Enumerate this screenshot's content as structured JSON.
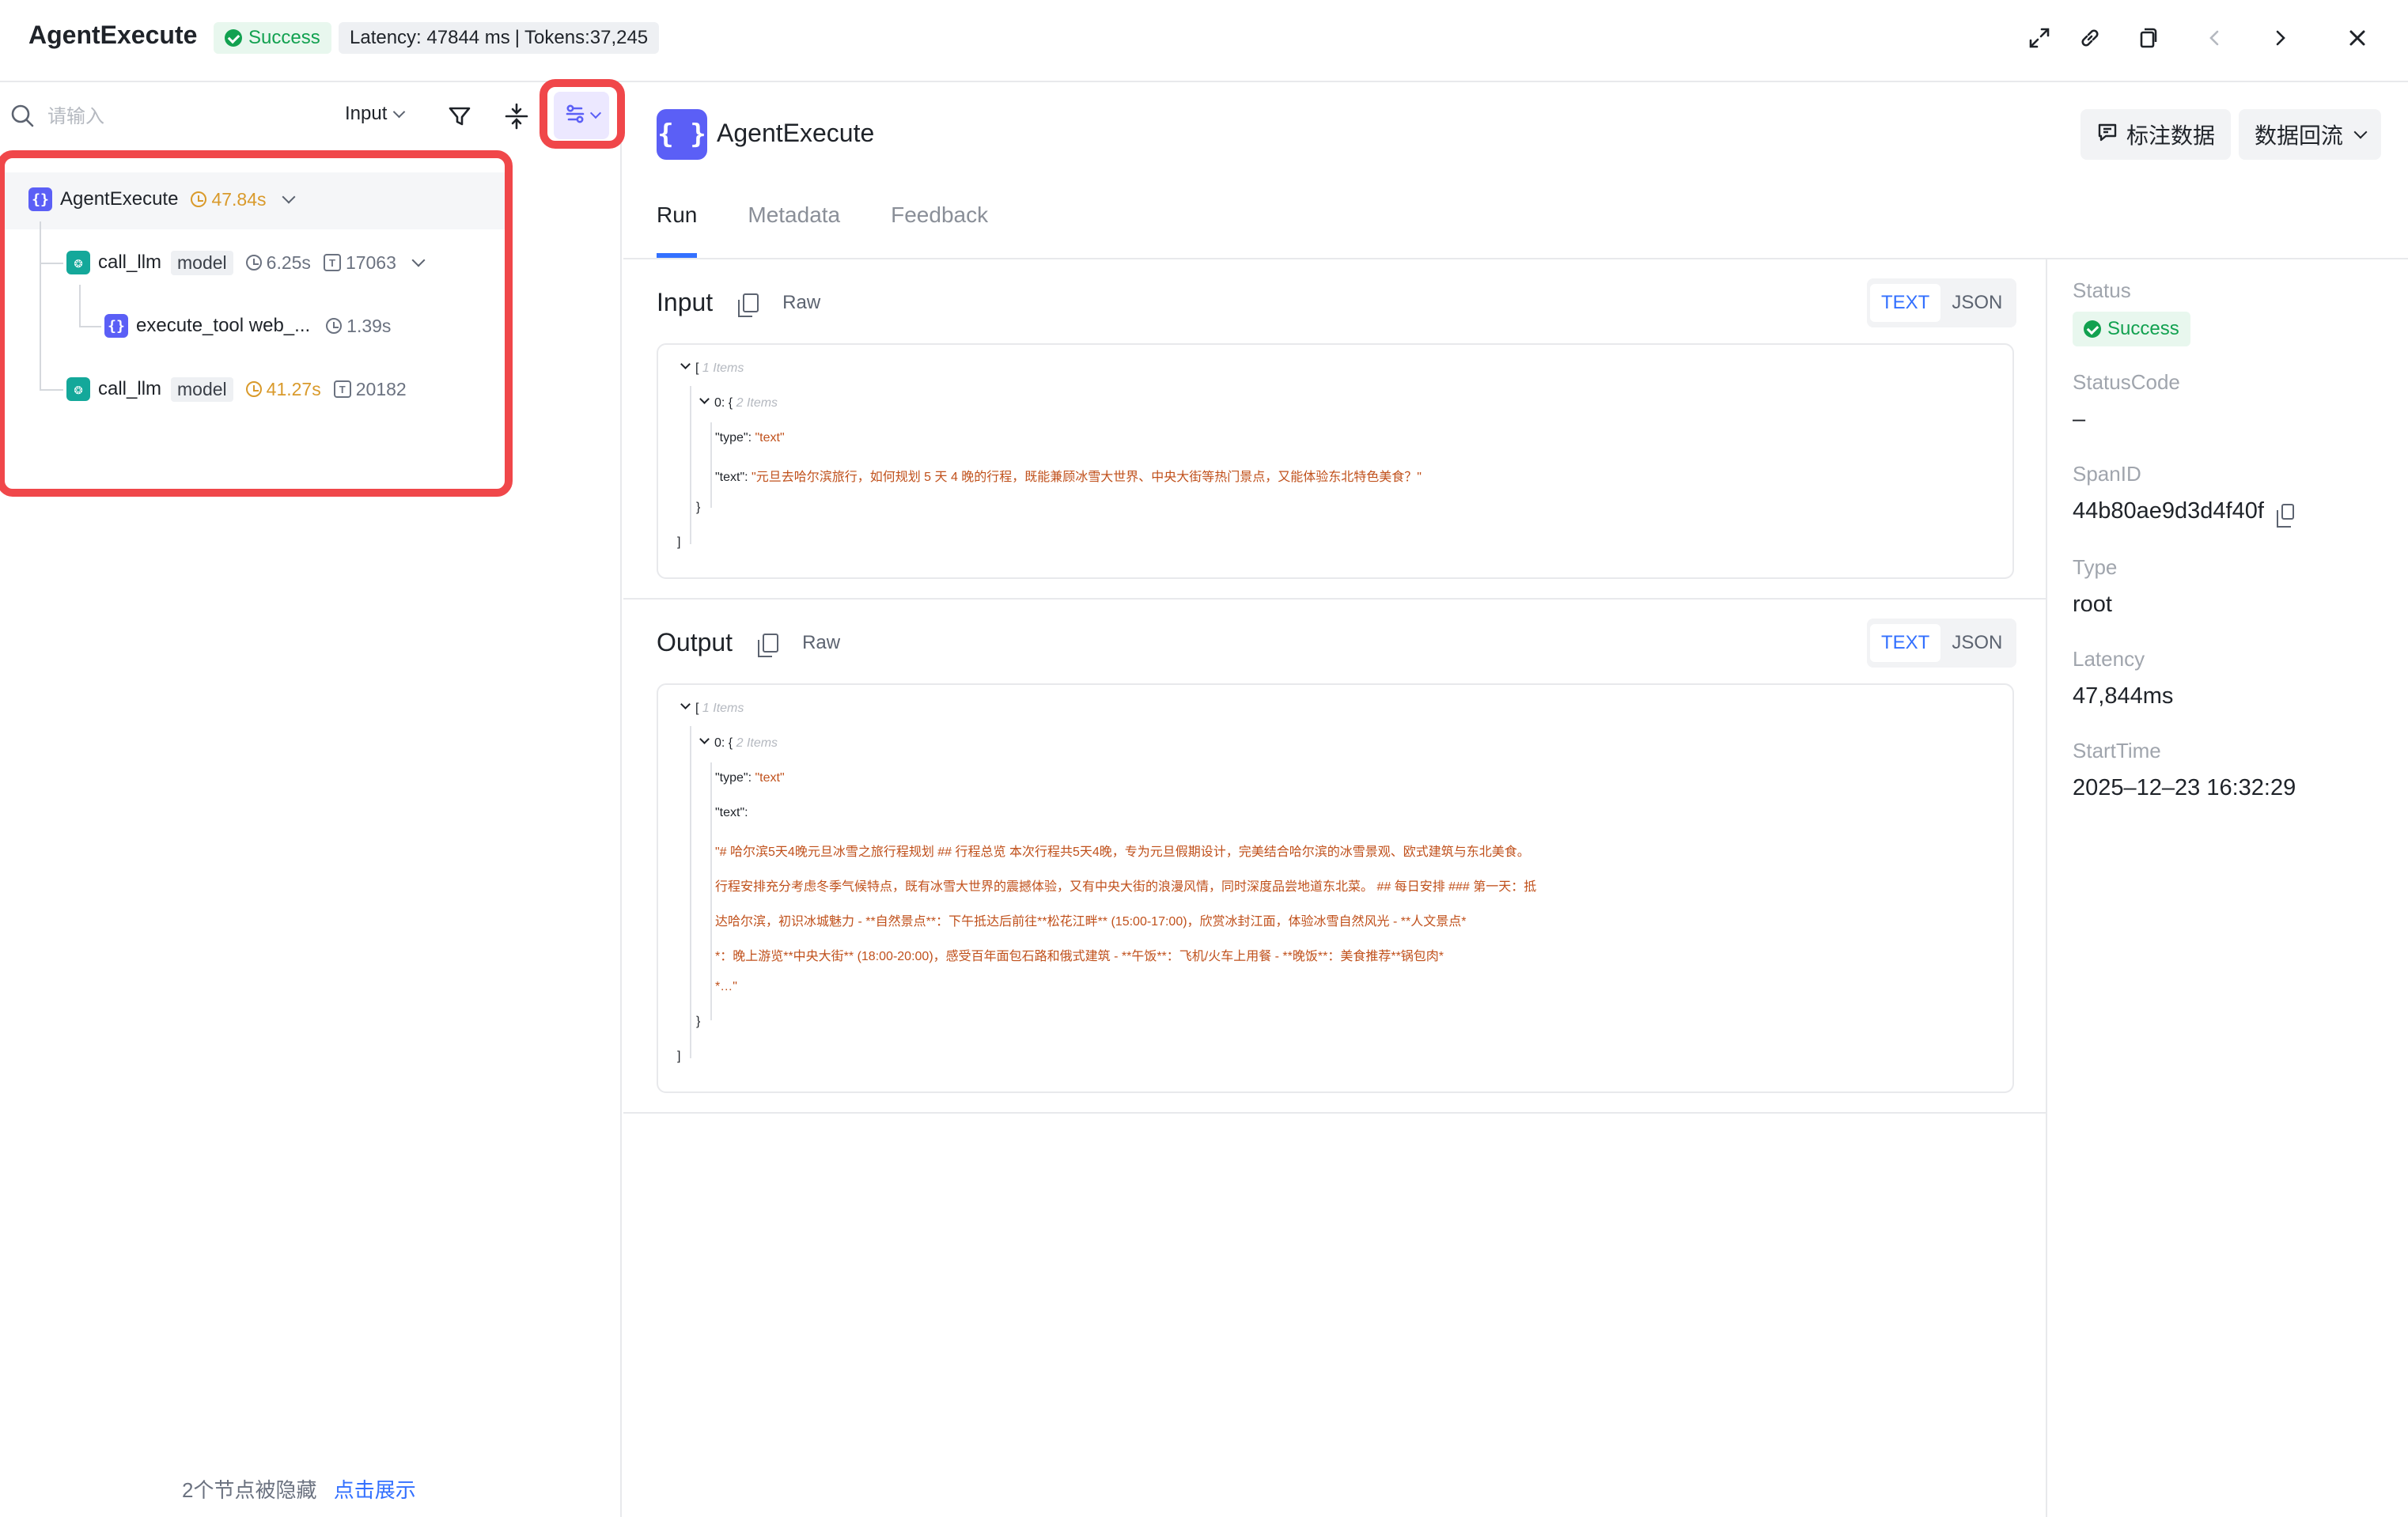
{
  "header": {
    "title": "AgentExecute",
    "status": "Success",
    "latency_text": "Latency: 47844 ms",
    "tokens_text": "Tokens:37,245",
    "separator": "|"
  },
  "left": {
    "search_placeholder": "请输入",
    "input_select": "Input",
    "tree": [
      {
        "name": "AgentExecute",
        "time": "47.84s"
      },
      {
        "name": "call_llm",
        "tag": "model",
        "time": "6.25s",
        "tokens": "17063"
      },
      {
        "name": "execute_tool web_...",
        "time": "1.39s"
      },
      {
        "name": "call_llm",
        "tag": "model",
        "time": "41.27s",
        "tokens": "20182"
      }
    ],
    "hidden_note": "2个节点被隐藏",
    "show_link": "点击展示"
  },
  "detail": {
    "title": "AgentExecute",
    "annotate_button": "标注数据",
    "reflow_button": "数据回流",
    "tabs": [
      "Run",
      "Metadata",
      "Feedback"
    ],
    "input": {
      "title": "Input",
      "raw": "Raw",
      "text_tab": "TEXT",
      "json_tab": "JSON",
      "open_bracket": "[",
      "items_note": "1 Items",
      "obj_index": "0:",
      "obj_open": "{",
      "obj_items_note": "2 Items",
      "type_key": "\"type\"",
      "type_value": "\"text\"",
      "text_key": "\"text\"",
      "text_value": "\"元旦去哈尔滨旅行，如何规划 5 天 4 晚的行程，既能兼顾冰雪大世界、中央大街等热门景点，又能体验东北特色美食？\"",
      "obj_close": "}",
      "close_bracket": "]"
    },
    "output": {
      "title": "Output",
      "raw": "Raw",
      "text_tab": "TEXT",
      "json_tab": "JSON",
      "open_bracket": "[",
      "items_note": "1 Items",
      "obj_index": "0:",
      "obj_open": "{",
      "obj_items_note": "2 Items",
      "type_key": "\"type\"",
      "type_value": "\"text\"",
      "text_key": "\"text\"",
      "text_lines": [
        "\"# 哈尔滨5天4晚元旦冰雪之旅行程规划 ## 行程总览 本次行程共5天4晚，专为元旦假期设计，完美结合哈尔滨的冰雪景观、欧式建筑与东北美食。",
        "行程安排充分考虑冬季气候特点，既有冰雪大世界的震撼体验，又有中央大街的浪漫风情，同时深度品尝地道东北菜。 ## 每日安排 ### 第一天：抵",
        "达哈尔滨，初识冰城魅力 - **自然景点**：下午抵达后前往**松花江畔** (15:00-17:00)，欣赏冰封江面，体验冰雪自然风光 - **人文景点*",
        "*：晚上游览**中央大街** (18:00-20:00)，感受百年面包石路和俄式建筑 - **午饭**：飞机/火车上用餐 - **晚饭**：美食推荐**锅包肉*",
        "*…\""
      ],
      "obj_close": "}",
      "close_bracket": "]"
    }
  },
  "props": {
    "status_label": "Status",
    "status_value": "Success",
    "status_code_label": "StatusCode",
    "status_code_value": "–",
    "span_id_label": "SpanID",
    "span_id_value": "44b80ae9d3d4f40f",
    "type_label": "Type",
    "type_value": "root",
    "latency_label": "Latency",
    "latency_value": "47,844ms",
    "start_time_label": "StartTime",
    "start_time_value": "2025–12–23 16:32:29"
  },
  "colors": {
    "accent": "#3370ff",
    "success": "#12a150",
    "agent_icon": "#5b5ff6",
    "llm_icon": "#14a89a",
    "highlight": "#f0474a",
    "string_value": "#c0501b"
  }
}
